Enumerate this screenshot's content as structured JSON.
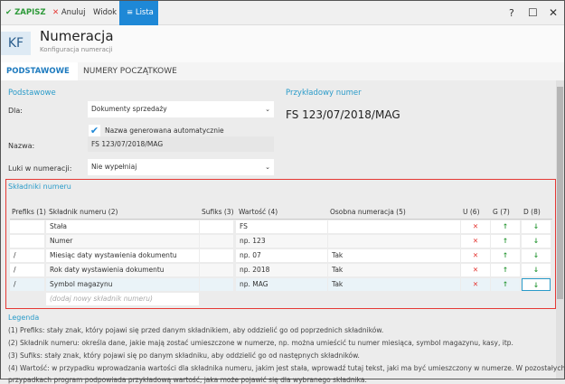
{
  "toolbar": {
    "save": "ZAPISZ",
    "cancel": "Anuluj",
    "view": "Widok",
    "list": "Lista",
    "help": "?"
  },
  "header": {
    "badge": "KF",
    "title": "Numeracja",
    "subtitle": "Konfiguracja numeracji"
  },
  "tabs": [
    "PODSTAWOWE",
    "NUMERY POCZĄTKOWE"
  ],
  "form": {
    "section": "Podstawowe",
    "dla_label": "Dla:",
    "dla_value": "Dokumenty sprzedaży",
    "auto_name": "Nazwa generowana automatycznie",
    "nazwa_label": "Nazwa:",
    "nazwa_value": "FS 123/07/2018/MAG",
    "luki_label": "Luki w numeracji:",
    "luki_value": "Nie wypełniaj"
  },
  "example": {
    "label": "Przykładowy numer",
    "value": "FS 123/07/2018/MAG"
  },
  "components": {
    "title": "Składniki numeru",
    "headers": [
      "Prefiks (1)",
      "Składnik numeru (2)",
      "Sufiks (3)",
      "Wartość (4)",
      "Osobna numeracja (5)",
      "U (6)",
      "G (7)",
      "D (8)"
    ],
    "rows": [
      {
        "prefix": "",
        "name": "Stała",
        "suffix": "",
        "value": "FS",
        "separate": ""
      },
      {
        "prefix": "",
        "name": "Numer",
        "suffix": "",
        "value": "np. 123",
        "separate": ""
      },
      {
        "prefix": "/",
        "name": "Miesiąc daty wystawienia dokumentu",
        "suffix": "",
        "value": "np. 07",
        "separate": "Tak"
      },
      {
        "prefix": "/",
        "name": "Rok daty wystawienia dokumentu",
        "suffix": "",
        "value": "np. 2018",
        "separate": "Tak"
      },
      {
        "prefix": "/",
        "name": "Symbol magazynu",
        "suffix": "",
        "value": "np. MAG",
        "separate": "Tak"
      }
    ],
    "add_placeholder": "(dodaj nowy składnik numeru)"
  },
  "legend": {
    "title": "Legenda",
    "lines": [
      "(1) Prefiks: stały znak, który pojawi się przed danym składnikiem, aby oddzielić go od poprzednich składników.",
      "(2) Składnik numeru: określa dane, jakie mają zostać umieszczone w numerze, np. można umieścić tu numer miesiąca, symbol magazynu, kasy, itp.",
      "(3) Sufiks: stały znak, który pojawi się po danym składniku, aby oddzielić go od następnych składników.",
      "(4) Wartość: w przypadku wprowadzania wartości dla składnika numeru, jakim jest stała,  wprowadź tutaj tekst, jaki ma być umieszczony  w numerze. W pozostałych",
      "przypadkach program podpowiada przykładową wartość, jaka może pojawić się dla wybranego składnika."
    ]
  }
}
